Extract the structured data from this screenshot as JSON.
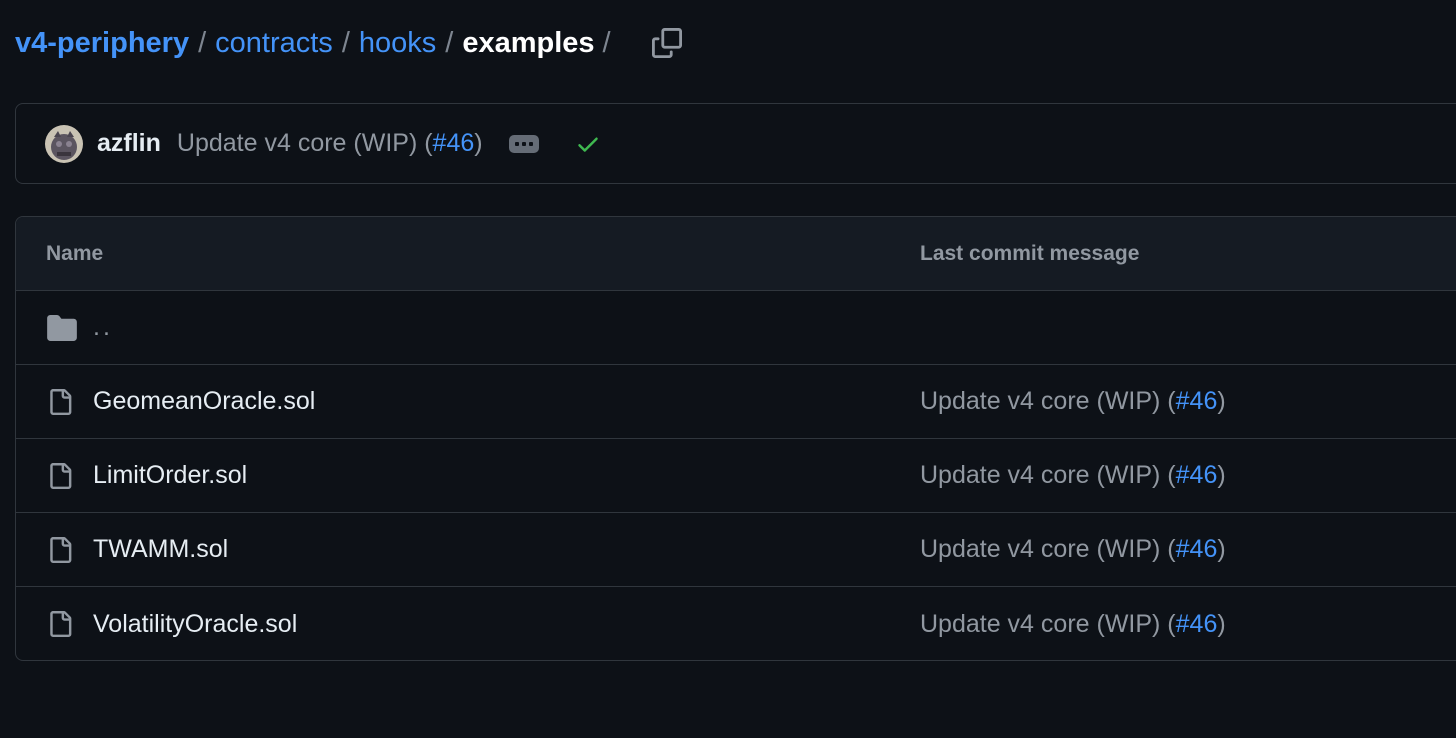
{
  "breadcrumb": {
    "root": "v4-periphery",
    "items": [
      "contracts",
      "hooks"
    ],
    "current": "examples",
    "separator": "/"
  },
  "commit": {
    "author": "azflin",
    "message": "Update v4 core (WIP)",
    "pr_open": "(",
    "pr_number": "#46",
    "pr_close": ")",
    "status": "success"
  },
  "table": {
    "headers": {
      "name": "Name",
      "last_commit": "Last commit message"
    },
    "parent_dir": "..",
    "files": [
      {
        "name": "GeomeanOracle.sol",
        "message": "Update v4 core (WIP) (",
        "pr": "#46",
        "close": ")"
      },
      {
        "name": "LimitOrder.sol",
        "message": "Update v4 core (WIP) (",
        "pr": "#46",
        "close": ")"
      },
      {
        "name": "TWAMM.sol",
        "message": "Update v4 core (WIP) (",
        "pr": "#46",
        "close": ")"
      },
      {
        "name": "VolatilityOracle.sol",
        "message": "Update v4 core (WIP) (",
        "pr": "#46",
        "close": ")"
      }
    ]
  },
  "colors": {
    "background": "#0d1117",
    "link": "#4493f8",
    "muted": "#9198a1",
    "border": "#30363d",
    "success": "#3fb950"
  }
}
